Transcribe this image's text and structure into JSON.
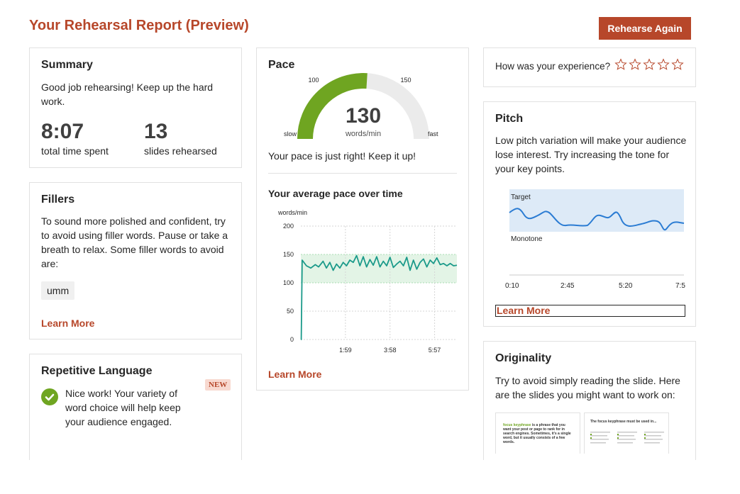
{
  "header": {
    "title": "Your Rehearsal Report (Preview)",
    "rehearse_label": "Rehearse Again"
  },
  "summary": {
    "title": "Summary",
    "message": "Good job rehearsing! Keep up the hard work.",
    "time_value": "8:07",
    "time_label": "total time spent",
    "slides_value": "13",
    "slides_label": "slides rehearsed"
  },
  "fillers": {
    "title": "Fillers",
    "message": "To sound more polished and confident, try to avoid using filler words. Pause or take a breath to relax. Some filler words to avoid are:",
    "words": [
      "umm"
    ],
    "learn_more": "Learn More"
  },
  "repetitive": {
    "title": "Repetitive Language",
    "badge": "NEW",
    "message": "Nice work! Your variety of word choice will help keep your audience engaged."
  },
  "pace": {
    "title": "Pace",
    "gauge_value": "130",
    "gauge_unit": "words/min",
    "gauge_fill_fraction": 0.52,
    "label_100": "100",
    "label_150": "150",
    "label_slow": "slow",
    "label_fast": "fast",
    "message": "Your pace is just right! Keep it up!",
    "chart_title": "Your average pace over time",
    "learn_more": "Learn More"
  },
  "experience": {
    "question": "How was your experience?",
    "stars": 5
  },
  "pitch": {
    "title": "Pitch",
    "message": "Low pitch variation will make your audience lose interest. Try increasing the tone for your key points.",
    "target_label": "Target",
    "monotone_label": "Monotone",
    "x_ticks": [
      "0:10",
      "2:45",
      "5:20",
      "7:5"
    ],
    "learn_more": "Learn More"
  },
  "originality": {
    "title": "Originality",
    "message": "Try to avoid simply reading the slide. Here are the slides you might want to work on:",
    "thumb1_highlight": "focus keyphrase",
    "thumb1_text": "is a phrase that you want your post or page to rank for in search engines. Sometimes, it's a single word, but it usually consists of a few words.",
    "thumb2_title": "The focus keyphrase must be used in..."
  },
  "colors": {
    "accent": "#b7472a",
    "green": "#6fa521",
    "teal": "#1b9a8a",
    "pitch_band": "#ddeaf7",
    "pitch_line": "#2b7cd3"
  },
  "chart_data": [
    {
      "type": "line",
      "title": "Your average pace over time",
      "ylabel": "words/min",
      "ylim": [
        0,
        200
      ],
      "yticks": [
        0,
        50,
        100,
        150,
        200
      ],
      "xlim": [
        0,
        7
      ],
      "xticks": [
        "1:59",
        "3:58",
        "5:57"
      ],
      "band": [
        100,
        150
      ],
      "series": [
        {
          "values": [
            [
              0.0,
              0
            ],
            [
              0.02,
              0
            ],
            [
              0.06,
              140
            ],
            [
              0.25,
              130
            ],
            [
              0.45,
              126
            ],
            [
              0.65,
              132
            ],
            [
              0.8,
              128
            ],
            [
              1.0,
              138
            ],
            [
              1.15,
              126
            ],
            [
              1.3,
              136
            ],
            [
              1.45,
              122
            ],
            [
              1.6,
              133
            ],
            [
              1.75,
              126
            ],
            [
              1.9,
              136
            ],
            [
              2.05,
              130
            ],
            [
              2.2,
              140
            ],
            [
              2.35,
              136
            ],
            [
              2.5,
              148
            ],
            [
              2.65,
              130
            ],
            [
              2.8,
              146
            ],
            [
              2.95,
              128
            ],
            [
              3.1,
              141
            ],
            [
              3.25,
              131
            ],
            [
              3.4,
              146
            ],
            [
              3.55,
              128
            ],
            [
              3.7,
              138
            ],
            [
              3.85,
              130
            ],
            [
              4.0,
              145
            ],
            [
              4.15,
              127
            ],
            [
              4.3,
              133
            ],
            [
              4.45,
              138
            ],
            [
              4.6,
              130
            ],
            [
              4.75,
              145
            ],
            [
              4.9,
              122
            ],
            [
              5.05,
              140
            ],
            [
              5.2,
              124
            ],
            [
              5.35,
              136
            ],
            [
              5.5,
              142
            ],
            [
              5.65,
              128
            ],
            [
              5.8,
              140
            ],
            [
              5.95,
              134
            ],
            [
              6.1,
              144
            ],
            [
              6.25,
              132
            ],
            [
              6.4,
              134
            ],
            [
              6.55,
              130
            ],
            [
              6.7,
              134
            ],
            [
              6.85,
              130
            ],
            [
              7.0,
              131
            ]
          ]
        }
      ]
    }
  ]
}
